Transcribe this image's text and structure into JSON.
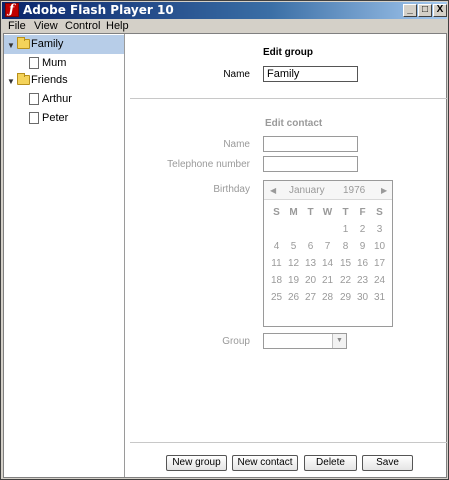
{
  "window": {
    "title": "Adobe Flash Player 10",
    "min_glyph": "_",
    "max_glyph": "□",
    "close_glyph": "X"
  },
  "menu": [
    "File",
    "View",
    "Control",
    "Help"
  ],
  "tree": [
    {
      "label": "Family",
      "type": "folder",
      "expanded": true,
      "selected": true,
      "arrow": "▼"
    },
    {
      "label": "Mum",
      "type": "contact"
    },
    {
      "label": "Friends",
      "type": "folder",
      "expanded": true,
      "arrow": "▼"
    },
    {
      "label": "Arthur",
      "type": "contact"
    },
    {
      "label": "Peter",
      "type": "contact"
    }
  ],
  "edit_group": {
    "heading": "Edit group",
    "name_label": "Name",
    "name_value": "Family"
  },
  "edit_contact": {
    "heading": "Edit contact",
    "name_label": "Name",
    "name_value": "",
    "phone_label": "Telephone number",
    "phone_value": "",
    "birthday_label": "Birthday",
    "group_label": "Group",
    "group_value": ""
  },
  "calendar": {
    "month": "January",
    "year": "1976",
    "prev": "◀",
    "next": "▶",
    "dow": [
      "S",
      "M",
      "T",
      "W",
      "T",
      "F",
      "S"
    ],
    "weeks": [
      [
        "",
        "",
        "",
        "",
        "1",
        "2",
        "3"
      ],
      [
        "4",
        "5",
        "6",
        "7",
        "8",
        "9",
        "10"
      ],
      [
        "11",
        "12",
        "13",
        "14",
        "15",
        "16",
        "17"
      ],
      [
        "18",
        "19",
        "20",
        "21",
        "22",
        "23",
        "24"
      ],
      [
        "25",
        "26",
        "27",
        "28",
        "29",
        "30",
        "31"
      ]
    ]
  },
  "buttons": {
    "new_group": "New group",
    "new_contact": "New contact",
    "delete": "Delete",
    "save": "Save"
  },
  "colors": {
    "selection": "#b7cde8",
    "titlebar": "#0a246a",
    "disabled_text": "#9a9a9a"
  }
}
